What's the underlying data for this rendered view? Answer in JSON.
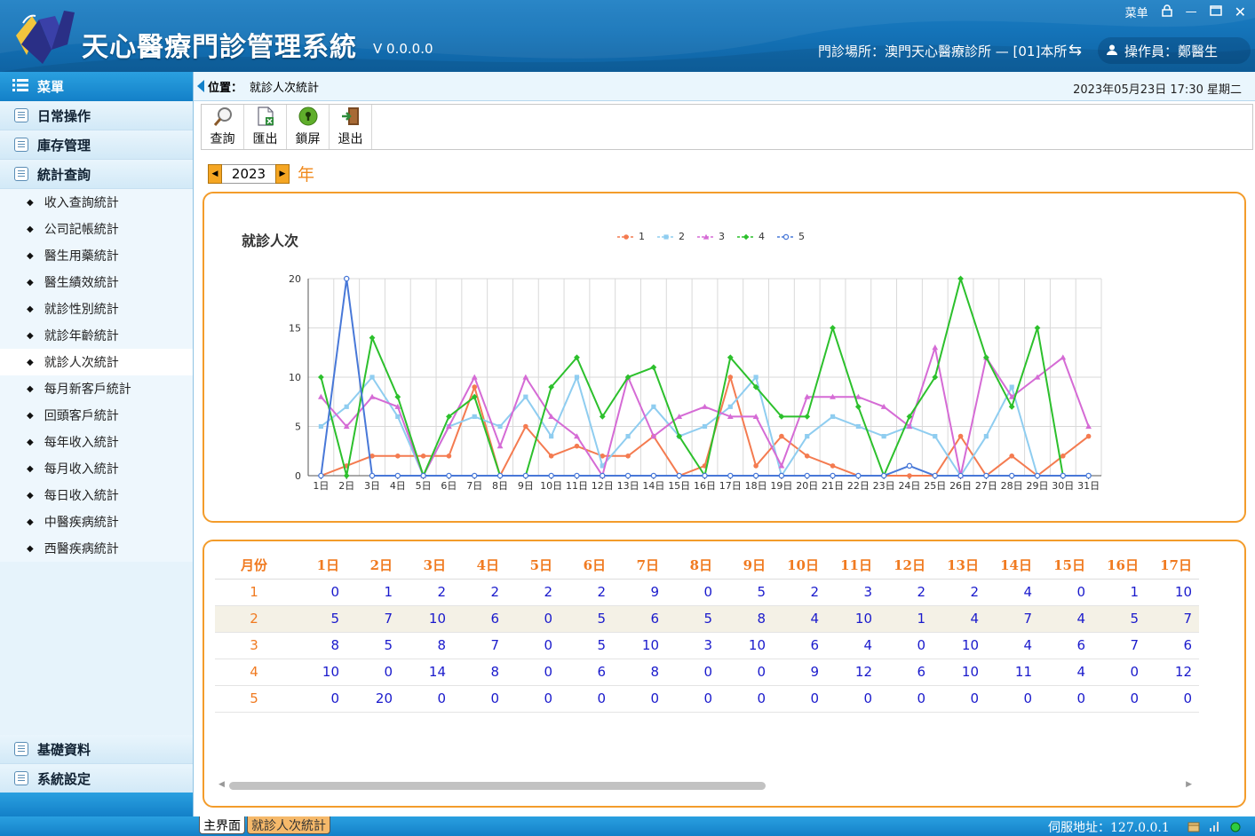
{
  "app": {
    "title": "天心醫療門診管理系統",
    "version": "V 0.0.0.0",
    "menu_label": "菜单",
    "clinic": "門診場所：澳門天心醫療診所 — [01]本所",
    "operator": "操作員：鄭醫生"
  },
  "sidebar": {
    "header": "菜單",
    "groups_top": [
      "日常操作",
      "庫存管理",
      "統計查詢"
    ],
    "items": [
      "收入查詢統計",
      "公司記帳統計",
      "醫生用藥統計",
      "醫生績效統計",
      "就診性別統計",
      "就診年齡統計",
      "就診人次統計",
      "每月新客戶統計",
      "回頭客戶統計",
      "每年收入統計",
      "每月收入統計",
      "每日收入統計",
      "中醫疾病統計",
      "西醫疾病統計"
    ],
    "active_item": "就診人次統計",
    "groups_bottom": [
      "基礎資料",
      "系統設定"
    ]
  },
  "location": {
    "label": "位置：",
    "path": "就診人次統計",
    "datetime": "2023年05月23日 17:30 星期二"
  },
  "toolbar": {
    "query": "查詢",
    "export": "匯出",
    "lock": "鎖屏",
    "exit": "退出"
  },
  "year_selector": {
    "value": "2023",
    "suffix": "年"
  },
  "colors": {
    "accent": "#f39c2b",
    "series": [
      "#f47b50",
      "#8fcdf0",
      "#d56bd5",
      "#2cc02c",
      "#4878d8"
    ]
  },
  "chart_data": {
    "type": "line",
    "title": "就診人次",
    "legend_position": "top-center",
    "ylim": [
      0,
      20
    ],
    "yticks": [
      0,
      5,
      10,
      15,
      20
    ],
    "grid": true,
    "categories": [
      "1日",
      "2日",
      "3日",
      "4日",
      "5日",
      "6日",
      "7日",
      "8日",
      "9日",
      "10日",
      "11日",
      "12日",
      "13日",
      "14日",
      "15日",
      "16日",
      "17日",
      "18日",
      "19日",
      "20日",
      "21日",
      "22日",
      "23日",
      "24日",
      "25日",
      "26日",
      "27日",
      "28日",
      "29日",
      "30日",
      "31日"
    ],
    "series": [
      {
        "name": "1",
        "values": [
          0,
          1,
          2,
          2,
          2,
          2,
          9,
          0,
          5,
          2,
          3,
          2,
          2,
          4,
          0,
          1,
          10,
          1,
          4,
          2,
          1,
          0,
          0,
          0,
          0,
          4,
          0,
          2,
          0,
          2,
          4
        ]
      },
      {
        "name": "2",
        "values": [
          5,
          7,
          10,
          6,
          0,
          5,
          6,
          5,
          8,
          4,
          10,
          1,
          4,
          7,
          4,
          5,
          7,
          10,
          0,
          4,
          6,
          5,
          4,
          5,
          4,
          0,
          4,
          9,
          0,
          0,
          0
        ]
      },
      {
        "name": "3",
        "values": [
          8,
          5,
          8,
          7,
          0,
          5,
          10,
          3,
          10,
          6,
          4,
          0,
          10,
          4,
          6,
          7,
          6,
          6,
          1,
          8,
          8,
          8,
          7,
          5,
          13,
          0,
          12,
          8,
          10,
          12,
          5
        ]
      },
      {
        "name": "4",
        "values": [
          10,
          0,
          14,
          8,
          0,
          6,
          8,
          0,
          0,
          9,
          12,
          6,
          10,
          11,
          4,
          0,
          12,
          9,
          6,
          6,
          15,
          7,
          0,
          6,
          10,
          20,
          12,
          7,
          15,
          0,
          0
        ]
      },
      {
        "name": "5",
        "values": [
          0,
          20,
          0,
          0,
          0,
          0,
          0,
          0,
          0,
          0,
          0,
          0,
          0,
          0,
          0,
          0,
          0,
          0,
          0,
          0,
          0,
          0,
          0,
          1,
          0,
          0,
          0,
          0,
          0,
          0,
          0
        ]
      }
    ]
  },
  "table": {
    "headers": [
      "月份",
      "1日",
      "2日",
      "3日",
      "4日",
      "5日",
      "6日",
      "7日",
      "8日",
      "9日",
      "10日",
      "11日",
      "12日",
      "13日",
      "14日",
      "15日",
      "16日",
      "17日"
    ],
    "rows": [
      [
        "1",
        "0",
        "1",
        "2",
        "2",
        "2",
        "2",
        "9",
        "0",
        "5",
        "2",
        "3",
        "2",
        "2",
        "4",
        "0",
        "1",
        "10"
      ],
      [
        "2",
        "5",
        "7",
        "10",
        "6",
        "0",
        "5",
        "6",
        "5",
        "8",
        "4",
        "10",
        "1",
        "4",
        "7",
        "4",
        "5",
        "7"
      ],
      [
        "3",
        "8",
        "5",
        "8",
        "7",
        "0",
        "5",
        "10",
        "3",
        "10",
        "6",
        "4",
        "0",
        "10",
        "4",
        "6",
        "7",
        "6"
      ],
      [
        "4",
        "10",
        "0",
        "14",
        "8",
        "0",
        "6",
        "8",
        "0",
        "0",
        "9",
        "12",
        "6",
        "10",
        "11",
        "4",
        "0",
        "12"
      ],
      [
        "5",
        "0",
        "20",
        "0",
        "0",
        "0",
        "0",
        "0",
        "0",
        "0",
        "0",
        "0",
        "0",
        "0",
        "0",
        "0",
        "0",
        "0"
      ]
    ]
  },
  "statusbar": {
    "tab_main": "主界面",
    "tab_current": "就診人次統計",
    "server": "伺服地址：127.0.0.1"
  }
}
